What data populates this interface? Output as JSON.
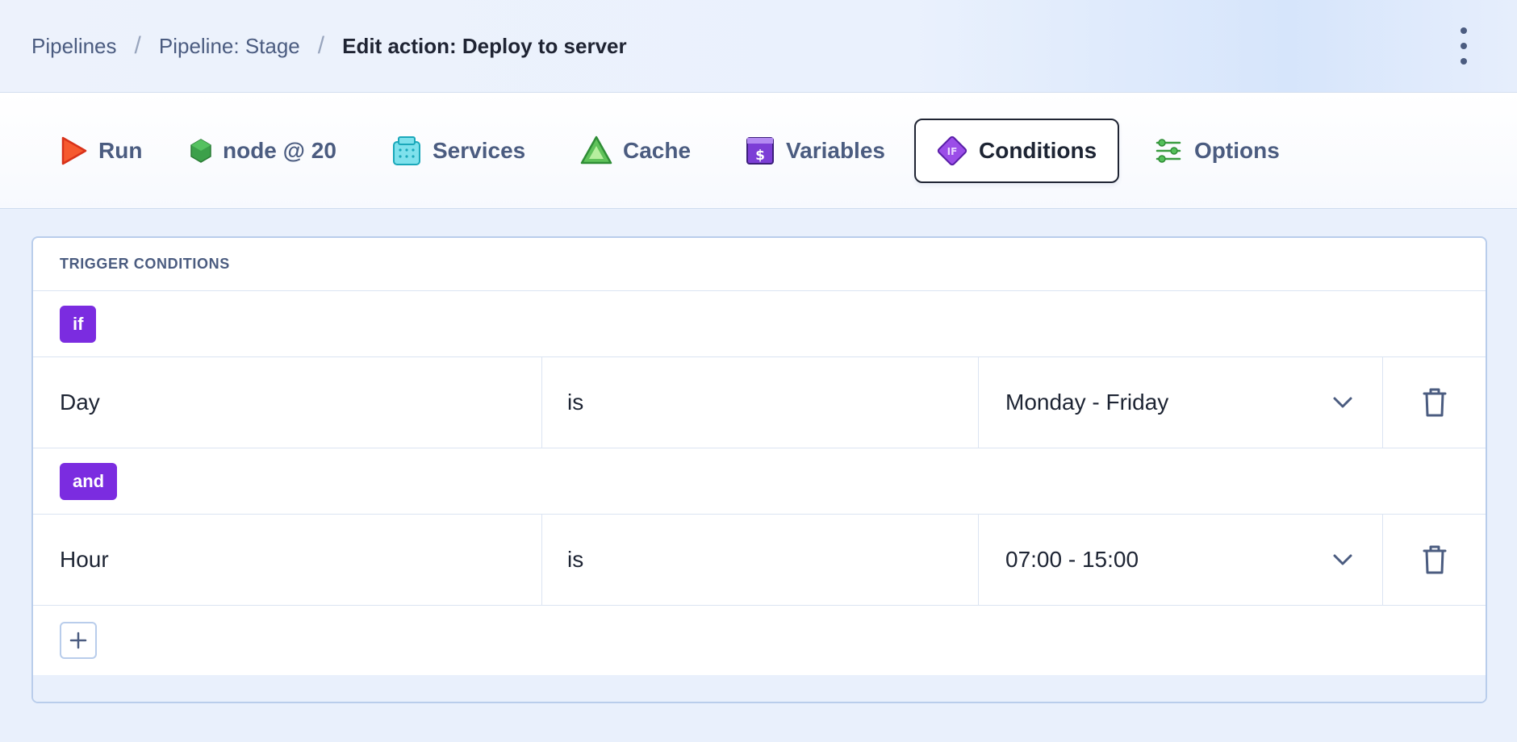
{
  "breadcrumb": {
    "items": [
      "Pipelines",
      "Pipeline: Stage"
    ],
    "current": "Edit action: Deploy to server",
    "separator": "/"
  },
  "tabs": [
    {
      "label": "Run",
      "icon": "play-icon"
    },
    {
      "label": "node @ 20",
      "icon": "hexagon-icon"
    },
    {
      "label": "Services",
      "icon": "services-icon"
    },
    {
      "label": "Cache",
      "icon": "triangle-icon"
    },
    {
      "label": "Variables",
      "icon": "dollar-icon"
    },
    {
      "label": "Conditions",
      "icon": "if-diamond-icon",
      "active": true
    },
    {
      "label": "Options",
      "icon": "sliders-icon"
    }
  ],
  "conditions": {
    "title": "TRIGGER CONDITIONS",
    "first_operator": "if",
    "rows": [
      {
        "field": "Day",
        "comparator": "is",
        "value": "Monday - Friday"
      },
      {
        "field": "Hour",
        "comparator": "is",
        "value": "07:00 - 15:00"
      }
    ],
    "join_operator": "and"
  },
  "colors": {
    "accent_purple": "#7b2ce0",
    "text_muted": "#4b5c80",
    "border": "#dbe4f2",
    "background": "#e9f0fc"
  }
}
